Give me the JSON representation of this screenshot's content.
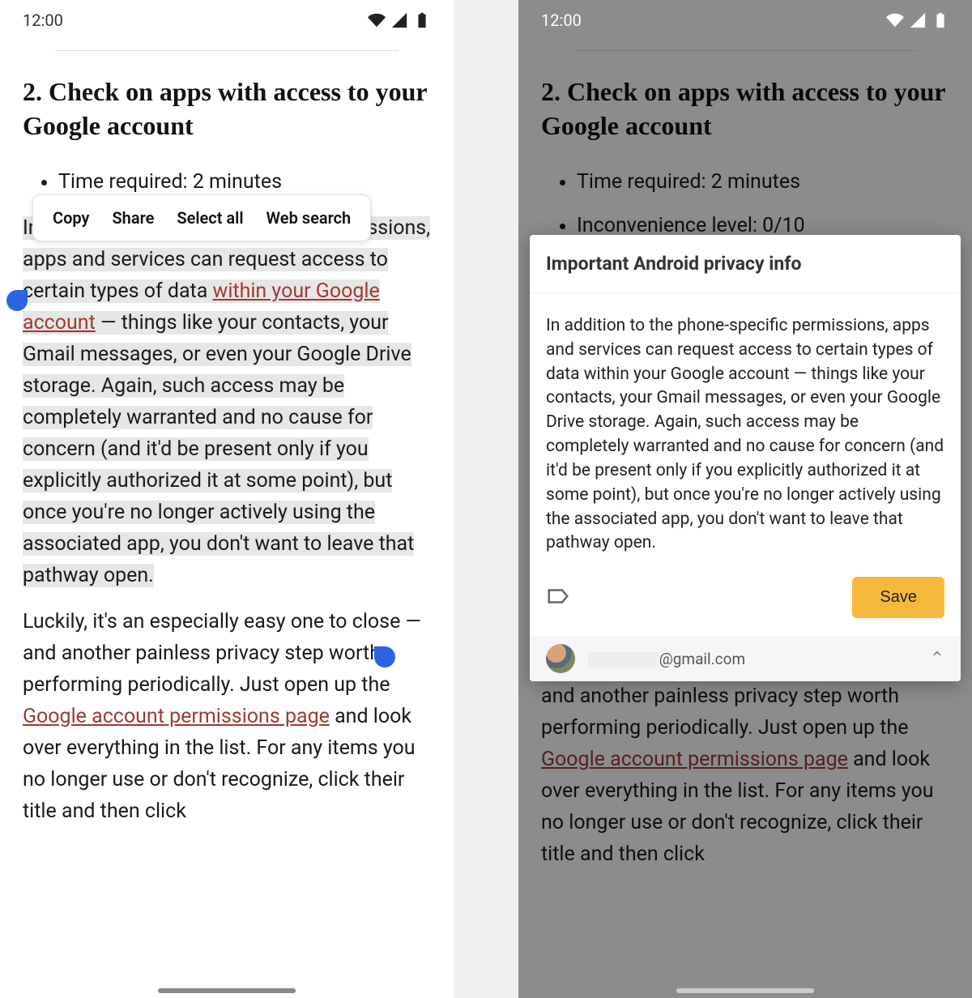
{
  "statusbar": {
    "time": "12:00"
  },
  "article": {
    "heading": "2. Check on apps with access to your Google account",
    "bullets": {
      "time_required": "Time required: 2 minutes",
      "inconvenience": "Inconvenience level: 0/10"
    },
    "p1_pre": "In addition to the phone-specific permissions, apps and services can request access to certain types of data ",
    "link1": "within your Google account",
    "p1_post": " — things like your contacts, your Gmail messages, or even your Google Drive storage. Again, such access may be completely warranted and no cause for concern (and it'd be present only if you explicitly authorized it at some point), but once you're no longer actively using the associated app, you don't want to leave that pathway open.",
    "p2_pre": "Luckily, it's an especially easy one to close — and another painless privacy step worth performing periodically. Just open up the ",
    "link2": "Google account permissions page",
    "p2_post": " and look over everything in the list. For any items you no longer use or don't recognize, click their title and then click"
  },
  "toolbar": {
    "copy": "Copy",
    "share": "Share",
    "select_all": "Select all",
    "web_search": "Web search"
  },
  "note": {
    "title": "Important Android privacy info",
    "body": "In addition to the phone-specific permissions, apps and services can request access to certain types of data within your Google account — things like your contacts, your Gmail messages, or even your Google Drive storage. Again, such access may be completely warranted and no cause for concern (and it'd be present only if you explicitly authorized it at some point), but once you're no longer actively using the associated app, you don't want to leave that pathway open.",
    "save": "Save",
    "email_domain": "@gmail.com"
  }
}
